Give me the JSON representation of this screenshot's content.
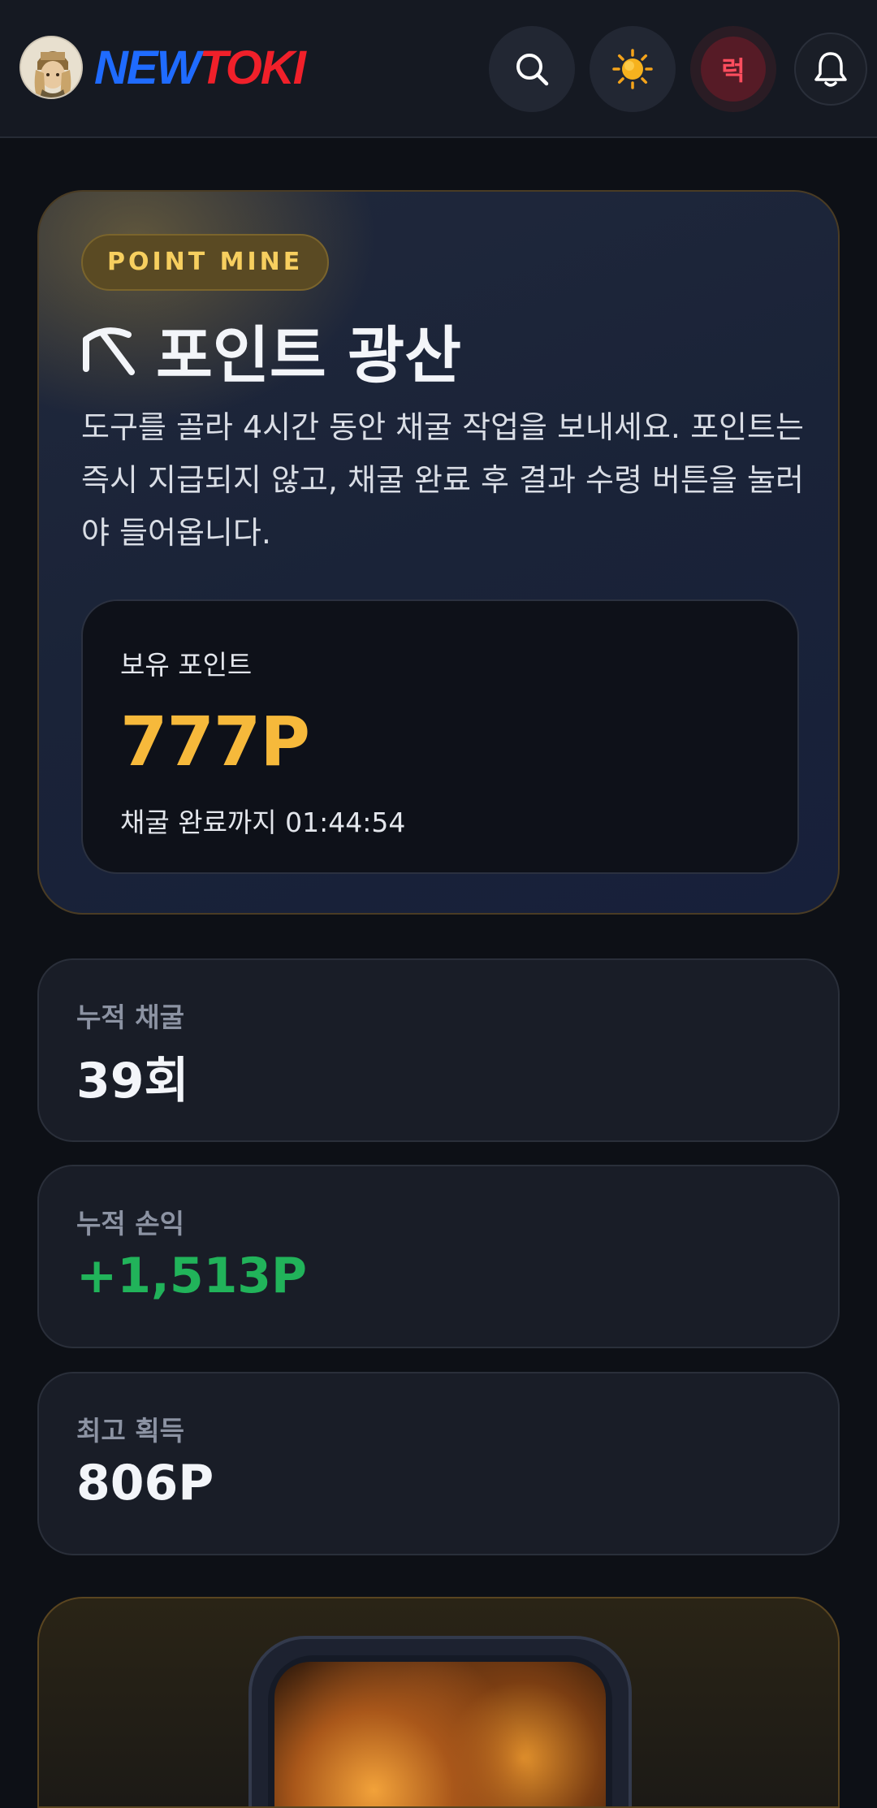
{
  "header": {
    "logo_part1": "NEW",
    "logo_part2": "TOKI",
    "search_icon": "search-icon",
    "theme_icon": "sun-icon",
    "luck_badge": "럭",
    "bell_icon": "bell-icon"
  },
  "hero": {
    "pill": "POINT MINE",
    "title_icon": "pickaxe-icon",
    "title": "포인트 광산",
    "description": "도구를 골라 4시간 동안 채굴 작업을 보내세요. 포인트는 즉시 지급되지 않고, 채굴 완료 후 결과 수령 버튼을 눌러야 들어옵니다.",
    "balance_label": "보유 포인트",
    "balance_value": "777P",
    "timer_text": "채굴 완료까지 01:44:54"
  },
  "stats": [
    {
      "label": "누적 채굴",
      "value": "39회"
    },
    {
      "label": "누적 손익",
      "value": "+1,513P"
    },
    {
      "label": "최고 획득",
      "value": "806P"
    }
  ],
  "colors": {
    "accent_gold": "#f6b93b",
    "profit_green": "#21b35a",
    "logo_blue": "#1f6bff",
    "logo_red": "#f0202a"
  }
}
